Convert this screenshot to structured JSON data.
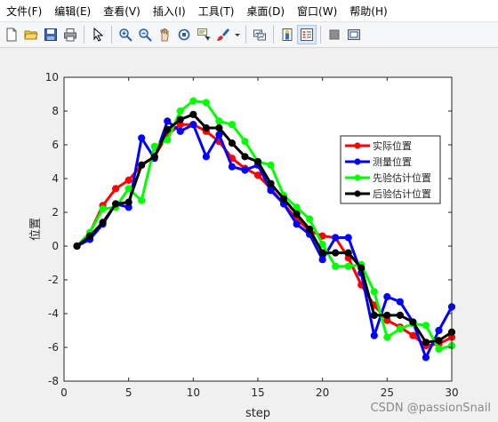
{
  "menubar": {
    "items": [
      "文件(F)",
      "编辑(E)",
      "查看(V)",
      "插入(I)",
      "工具(T)",
      "桌面(D)",
      "窗口(W)",
      "帮助(H)"
    ]
  },
  "toolbar": {
    "icons": [
      "new-file-icon",
      "open-folder-icon",
      "save-icon",
      "print-icon",
      "pointer-icon",
      "zoom-in-icon",
      "zoom-out-icon",
      "pan-hand-icon",
      "rotate-3d-icon",
      "data-cursor-icon",
      "brush-icon",
      "link-plot-icon",
      "colorbar-icon",
      "legend-icon",
      "hide-plot-tools-icon",
      "show-plot-tools-icon"
    ]
  },
  "chart_data": {
    "type": "line",
    "title": "",
    "xlabel": "step",
    "ylabel": "位置",
    "xlim": [
      0,
      30
    ],
    "ylim": [
      -8,
      10
    ],
    "xticks": [
      0,
      5,
      10,
      15,
      20,
      25,
      30
    ],
    "yticks": [
      -8,
      -6,
      -4,
      -2,
      0,
      2,
      4,
      6,
      8,
      10
    ],
    "grid": false,
    "legend_position": "top-right",
    "x": [
      1,
      2,
      3,
      4,
      5,
      6,
      7,
      8,
      9,
      10,
      11,
      12,
      13,
      14,
      15,
      16,
      17,
      18,
      19,
      20,
      21,
      22,
      23,
      24,
      25,
      26,
      27,
      28,
      29,
      30
    ],
    "series": [
      {
        "name": "实际位置",
        "color": "#ff0000",
        "values": [
          0,
          0.8,
          2.4,
          3.4,
          3.9,
          4.8,
          5.3,
          6.6,
          7.2,
          7.2,
          6.8,
          6.2,
          5.2,
          4.6,
          4.2,
          3.4,
          2.5,
          1.6,
          0.9,
          0.6,
          0.5,
          -0.7,
          -2.3,
          -3.5,
          -4.4,
          -4.8,
          -5.3,
          -5.9,
          -5.8,
          -5.4
        ]
      },
      {
        "name": "测量位置",
        "color": "#0000ff",
        "values": [
          0,
          0.4,
          1.3,
          2.5,
          2.3,
          6.4,
          5.2,
          7.4,
          6.8,
          7.2,
          5.3,
          6.6,
          4.7,
          4.5,
          4.8,
          3.3,
          2.5,
          1.3,
          0.7,
          -0.8,
          0.5,
          0.5,
          -1.6,
          -5.3,
          -3.0,
          -3.3,
          -4.5,
          -6.6,
          -5.0,
          -3.6
        ]
      },
      {
        "name": "先验估计位置",
        "color": "#00ff00",
        "values": [
          0,
          0.8,
          2.2,
          2.3,
          3.4,
          2.7,
          5.9,
          6.3,
          8.0,
          8.6,
          8.5,
          7.4,
          7.2,
          6.2,
          5.0,
          4.8,
          3.0,
          2.3,
          1.6,
          0.1,
          -1.2,
          -1.2,
          -1.1,
          -2.7,
          -5.4,
          -4.9,
          -4.6,
          -4.7,
          -6.1,
          -5.9
        ]
      },
      {
        "name": "后验估计位置",
        "color": "#000000",
        "values": [
          0,
          0.6,
          1.4,
          2.5,
          2.6,
          4.8,
          5.3,
          6.9,
          7.5,
          7.8,
          7.0,
          7.0,
          6.1,
          5.3,
          5.0,
          3.7,
          2.8,
          1.9,
          1.0,
          -0.4,
          -0.4,
          -0.4,
          -1.3,
          -4.1,
          -4.1,
          -4.1,
          -4.5,
          -5.7,
          -5.6,
          -5.1
        ]
      }
    ]
  },
  "watermark": "CSDN @passionSnail"
}
